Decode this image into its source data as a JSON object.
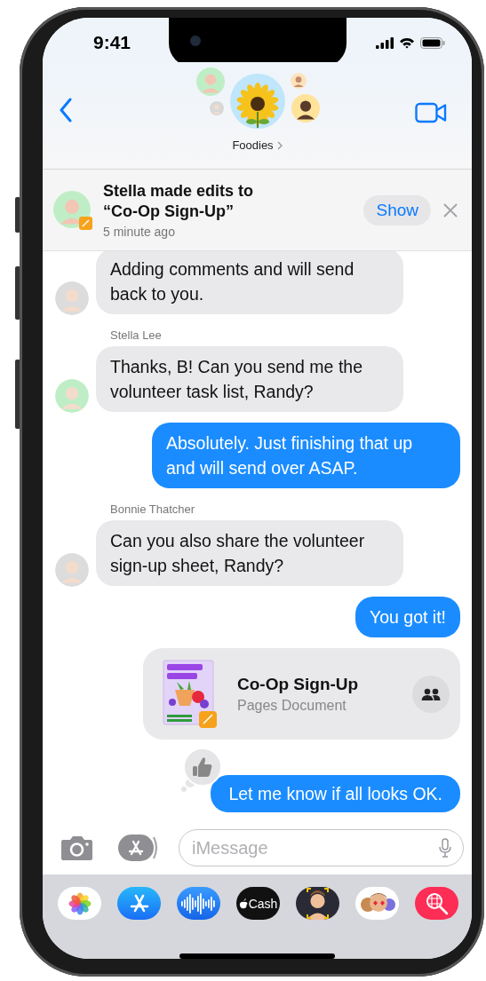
{
  "status_bar": {
    "time": "9:41"
  },
  "header": {
    "group_name": "Foodies"
  },
  "banner": {
    "title": "Stella made edits to “Co-Op Sign-Up”",
    "subtitle": "5 minute ago",
    "action": "Show"
  },
  "messages": [
    {
      "kind": "received",
      "text": "Adding comments and will send back to you.",
      "color": "#dcdcdc"
    },
    {
      "kind": "received",
      "sender": "Stella Lee",
      "text": "Thanks, B! Can you send me the volunteer task list, Randy?",
      "color": "#bfeec6"
    },
    {
      "kind": "sent",
      "text": "Absolutely. Just finishing that up and will send over ASAP.",
      "tapback": false
    },
    {
      "kind": "received",
      "sender": "Bonnie Thatcher",
      "text": "Can you also share the volunteer sign-up sheet, Randy?",
      "color": "#dcdcdc"
    },
    {
      "kind": "sent",
      "text": "You got it!",
      "tapback": false
    },
    {
      "kind": "attachment",
      "title": "Co-Op Sign-Up",
      "subtitle": "Pages Document"
    },
    {
      "kind": "sent",
      "text": "Let me know if all looks OK.",
      "tapback": true
    }
  ],
  "composer": {
    "placeholder": "iMessage"
  },
  "apps": [
    {
      "kind": "photos"
    },
    {
      "kind": "store"
    },
    {
      "kind": "audio"
    },
    {
      "kind": "cash",
      "label": "Cash"
    },
    {
      "kind": "memoji"
    },
    {
      "kind": "stickers"
    },
    {
      "kind": "search"
    }
  ]
}
